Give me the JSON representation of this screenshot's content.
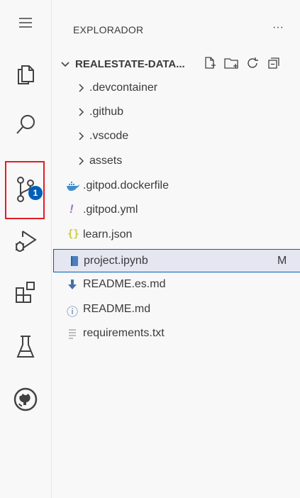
{
  "activity_bar": {
    "items": [
      {
        "icon": "menu-icon"
      },
      {
        "icon": "files-icon"
      },
      {
        "icon": "search-icon"
      },
      {
        "icon": "source-control-icon",
        "badge": "1"
      },
      {
        "icon": "run-debug-icon"
      },
      {
        "icon": "extensions-icon"
      },
      {
        "icon": "testing-icon"
      },
      {
        "icon": "github-icon"
      }
    ]
  },
  "explorer": {
    "title": "EXPLORADOR",
    "more": "···",
    "section_title": "REALESTATE-DATA...",
    "items": [
      {
        "label": ".devcontainer",
        "type": "folder"
      },
      {
        "label": ".github",
        "type": "folder"
      },
      {
        "label": ".vscode",
        "type": "folder"
      },
      {
        "label": "assets",
        "type": "folder"
      },
      {
        "label": ".gitpod.dockerfile",
        "type": "docker",
        "icon_color": "#3f8fcf"
      },
      {
        "label": ".gitpod.yml",
        "type": "yaml",
        "icon_glyph": "!",
        "icon_color": "#a074c4"
      },
      {
        "label": "learn.json",
        "type": "json",
        "icon_glyph": "{}",
        "icon_color": "#cbcb41"
      },
      {
        "label": "project.ipynb",
        "type": "notebook",
        "status": "M",
        "selected": true,
        "icon_color": "#4a7fbf"
      },
      {
        "label": "README.es.md",
        "type": "markdown-download",
        "icon_color": "#4a6fa5"
      },
      {
        "label": "README.md",
        "type": "info",
        "icon_glyph": "ⓘ",
        "icon_color": "#4a6fa5"
      },
      {
        "label": "requirements.txt",
        "type": "text",
        "icon_color": "#9a9a9a"
      }
    ]
  }
}
